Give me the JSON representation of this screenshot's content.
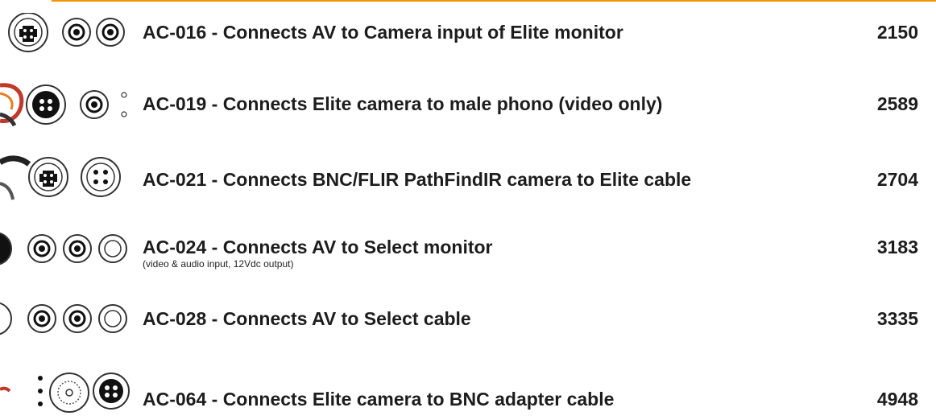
{
  "accent_color": "#f39200",
  "products": [
    {
      "code_title": "AC-016 - Connects AV to Camera input of Elite monitor",
      "subtitle": "",
      "part_number": "2150",
      "icons": [
        "cable-photo-fragment-icon",
        "svideo-4pin-connector-icon",
        "rca-jack-icon",
        "rca-jack-icon"
      ]
    },
    {
      "code_title": "AC-019 - Connects Elite camera to male phono (video only)",
      "subtitle": "",
      "part_number": "2589",
      "icons": [
        "cable-photo-fragment-icon",
        "svideo-connector-filled-icon",
        "rca-jack-icon",
        "pin-pair-icon"
      ]
    },
    {
      "code_title": "AC-021 - Connects BNC/FLIR PathFindIR camera to Elite cable",
      "subtitle": "",
      "part_number": "2704",
      "icons": [
        "cable-photo-fragment-icon",
        "svideo-4pin-connector-icon",
        "four-pin-connector-icon"
      ]
    },
    {
      "code_title": "AC-024 - Connects AV to Select monitor",
      "subtitle": "(video & audio input, 12Vdc output)",
      "part_number": "3183",
      "icons": [
        "cable-photo-fragment-icon",
        "rca-jack-icon",
        "rca-jack-icon",
        "open-ring-jack-icon"
      ]
    },
    {
      "code_title": "AC-028 - Connects AV to Select cable",
      "subtitle": "",
      "part_number": "3335",
      "icons": [
        "cable-photo-fragment-icon",
        "rca-jack-icon",
        "rca-jack-icon",
        "open-ring-jack-icon"
      ]
    },
    {
      "code_title": "AC-064 - Connects Elite camera to BNC adapter cable",
      "subtitle": "",
      "part_number": "4948",
      "icons": [
        "cable-photo-fragment-icon",
        "pin-pair-icon",
        "bnc-connector-icon",
        "svideo-connector-filled-icon"
      ]
    }
  ]
}
